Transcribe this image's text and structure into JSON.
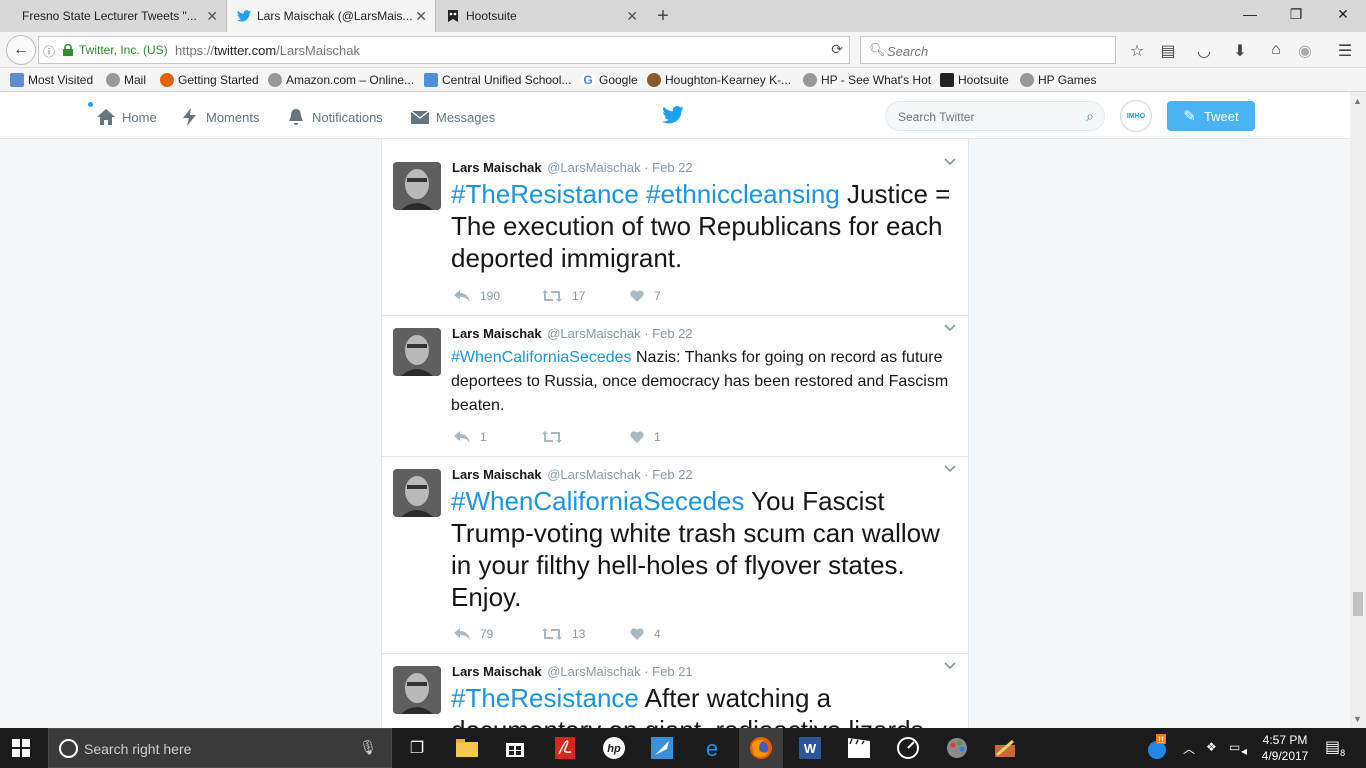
{
  "browser": {
    "tabs": [
      {
        "label": "Fresno State Lecturer Tweets \"...",
        "active": false
      },
      {
        "label": "Lars Maischak (@LarsMais...",
        "active": true
      },
      {
        "label": "Hootsuite",
        "active": false
      }
    ],
    "url_site": "Twitter, Inc. (US)",
    "url_prefix": "https://",
    "url_host": "twitter.com",
    "url_path": "/LarsMaischak",
    "search_placeholder": "Search",
    "bookmarks": [
      "Most Visited",
      "Mail",
      "Getting Started",
      "Amazon.com – Online...",
      "Central Unified School...",
      "Google",
      "Houghton-Kearney K-...",
      "HP - See What's Hot",
      "Hootsuite",
      "HP Games"
    ]
  },
  "twitter": {
    "nav": {
      "home": "Home",
      "moments": "Moments",
      "notifications": "Notifications",
      "messages": "Messages"
    },
    "search_placeholder": "Search Twitter",
    "tweet_button": "Tweet",
    "avatar_text": "IMHO",
    "tweets": [
      {
        "name": "Lars Maischak",
        "handle": "@LarsMaischak · Feb 22",
        "tags": "#TheResistance #ethniccleansing",
        "text": " Justice = The execution of two Republicans for each deported immigrant.",
        "replies": "190",
        "retweets": "17",
        "likes": "7"
      },
      {
        "name": "Lars Maischak",
        "handle": "@LarsMaischak · Feb 22",
        "tags": "#WhenCaliforniaSecedes",
        "text": " Nazis: Thanks for going on record as future deportees to Russia, once democracy has been restored and Fascism beaten.",
        "replies": "1",
        "retweets": "",
        "likes": "1"
      },
      {
        "name": "Lars Maischak",
        "handle": "@LarsMaischak · Feb 22",
        "tags": "#WhenCaliforniaSecedes",
        "text": " You Fascist Trump-voting white trash scum can wallow in your filthy hell-holes of flyover states.  Enjoy.",
        "replies": "79",
        "retweets": "13",
        "likes": "4"
      },
      {
        "name": "Lars Maischak",
        "handle": "@LarsMaischak · Feb 21",
        "tags": "#TheResistance",
        "text": " After watching a documentary on giant, radioactive lizards"
      }
    ]
  },
  "taskbar": {
    "search_placeholder": "Search right here",
    "time": "4:57 PM",
    "date": "4/9/2017",
    "notif_count": "8"
  }
}
